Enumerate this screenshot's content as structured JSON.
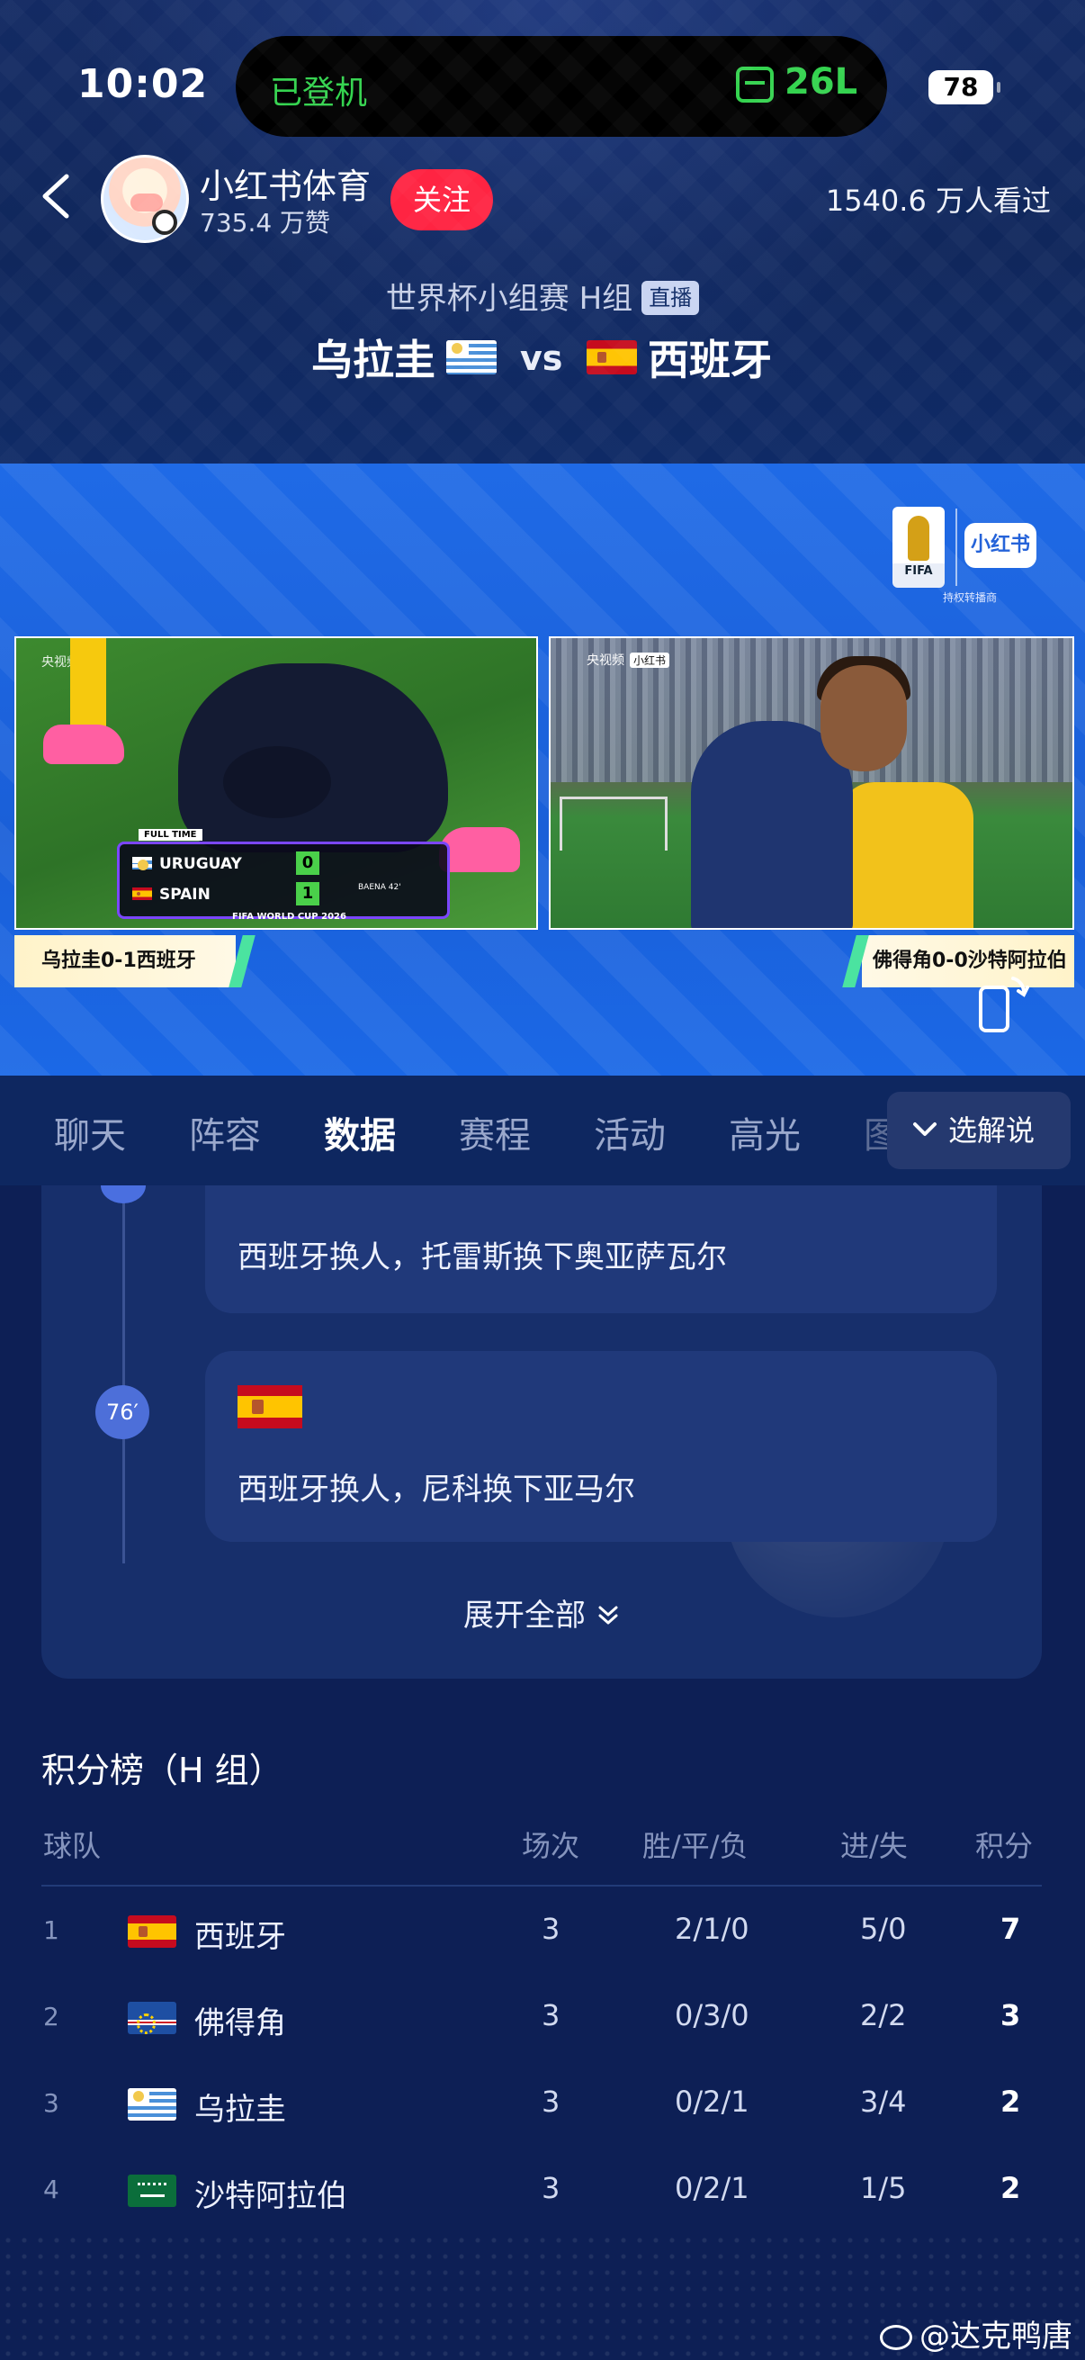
{
  "status_bar": {
    "time": "10:02",
    "island_status": "已登机",
    "island_value": "26L",
    "battery": "78"
  },
  "account": {
    "name": "小红书体育",
    "likes": "735.4 万赞",
    "follow_label": "关注",
    "viewers": "1540.6 万人看过"
  },
  "match": {
    "stage": "世界杯小组赛 H组",
    "live_tag": "直播",
    "team_left": "乌拉圭",
    "vs": "vs",
    "team_right": "西班牙"
  },
  "video": {
    "broadcaster": "央视频",
    "partner_tag": "小红书",
    "wc_logo_text": "FIFA",
    "logo_caption": "持权转播商",
    "scoreboard": {
      "full_time": "FULL TIME",
      "team1": "URUGUAY",
      "score1": "0",
      "team2": "SPAIN",
      "score2": "1",
      "event": "FIFA WORLD CUP 2026",
      "clock": "BAENA 42'"
    },
    "caption_left": "乌拉圭0-1西班牙",
    "caption_right": "佛得角0-0沙特阿拉伯"
  },
  "tabs": [
    {
      "label": "聊天"
    },
    {
      "label": "阵容"
    },
    {
      "label": "数据"
    },
    {
      "label": "赛程"
    },
    {
      "label": "活动"
    },
    {
      "label": "高光"
    },
    {
      "label": "图"
    }
  ],
  "active_tab": "数据",
  "commentary_button": "选解说",
  "events": [
    {
      "text": "西班牙换人，托雷斯换下奥亚萨瓦尔"
    },
    {
      "minute": "76′",
      "text": "西班牙换人，尼科换下亚马尔"
    }
  ],
  "expand_label": "展开全部",
  "standings": {
    "title": "积分榜（H 组）",
    "headers": {
      "team": "球队",
      "played": "场次",
      "wdl": "胜/平/负",
      "goals": "进/失",
      "points": "积分"
    },
    "rows": [
      {
        "rank": "1",
        "flag": "spain-flag",
        "team": "西班牙",
        "played": "3",
        "wdl": "2/1/0",
        "goals": "5/0",
        "points": "7"
      },
      {
        "rank": "2",
        "flag": "cape-verde-flag",
        "team": "佛得角",
        "played": "3",
        "wdl": "0/3/0",
        "goals": "2/2",
        "points": "3"
      },
      {
        "rank": "3",
        "flag": "uruguay-flag",
        "team": "乌拉圭",
        "played": "3",
        "wdl": "0/2/1",
        "goals": "3/4",
        "points": "2"
      },
      {
        "rank": "4",
        "flag": "saudi-arabia-flag",
        "team": "沙特阿拉伯",
        "played": "3",
        "wdl": "0/2/1",
        "goals": "1/5",
        "points": "2"
      }
    ]
  },
  "watermark": "@达克鸭唐",
  "colors": {
    "brand_red": "#ff2442",
    "accent_blue": "#1f6ae6",
    "island_green": "#34d34f",
    "background": "#0d1f55"
  }
}
